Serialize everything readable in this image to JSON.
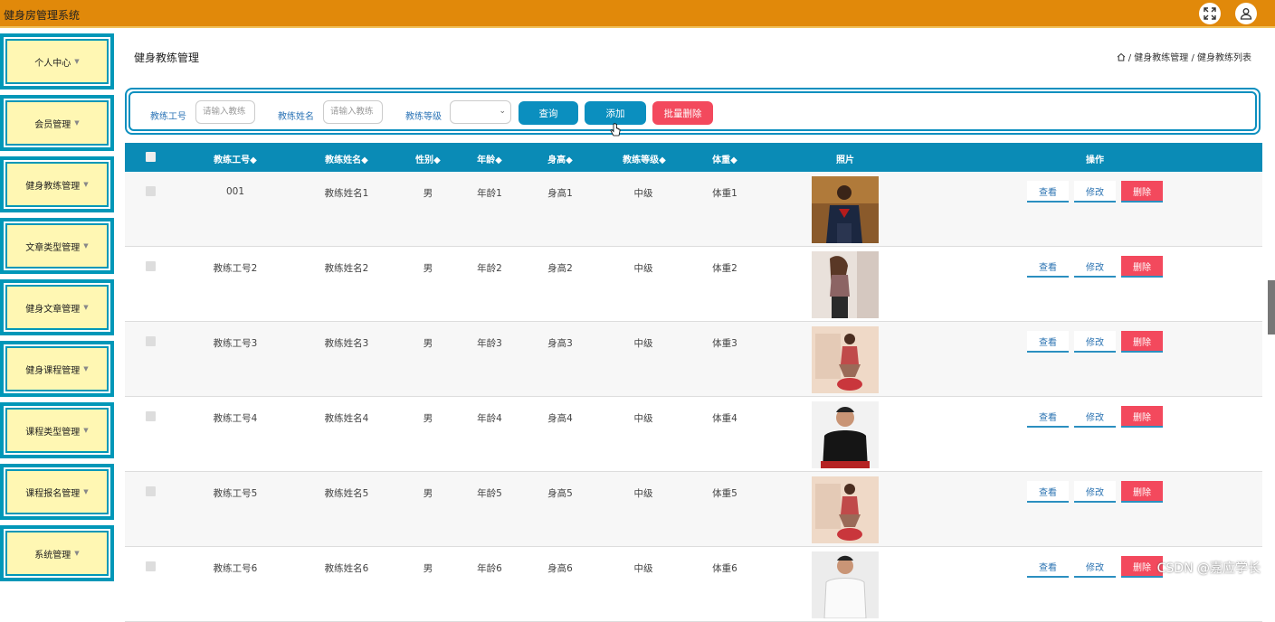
{
  "app": {
    "title": "健身房管理系统"
  },
  "sidebar": {
    "items": [
      {
        "label": "个人中心"
      },
      {
        "label": "会员管理"
      },
      {
        "label": "健身教练管理"
      },
      {
        "label": "文章类型管理"
      },
      {
        "label": "健身文章管理"
      },
      {
        "label": "健身课程管理"
      },
      {
        "label": "课程类型管理"
      },
      {
        "label": "课程报名管理"
      },
      {
        "label": "系统管理"
      }
    ]
  },
  "page": {
    "title": "健身教练管理",
    "breadcrumb": "/ 健身教练管理 / 健身教练列表"
  },
  "search": {
    "id_label": "教练工号",
    "id_placeholder": "请输入教练",
    "name_label": "教练姓名",
    "name_placeholder": "请输入教练",
    "level_label": "教练等级",
    "query": "查询",
    "add": "添加",
    "batch_delete": "批量删除"
  },
  "table": {
    "headers": [
      "教练工号◆",
      "教练姓名◆",
      "性别◆",
      "年龄◆",
      "身高◆",
      "教练等级◆",
      "体重◆",
      "照片",
      "操作"
    ],
    "actions": {
      "view": "查看",
      "edit": "修改",
      "delete": "删除"
    },
    "rows": [
      {
        "id": "001",
        "name": "教练姓名1",
        "gender": "男",
        "age": "年龄1",
        "height": "身高1",
        "level": "中级",
        "weight": "体重1",
        "photo": "man-dark-shirt"
      },
      {
        "id": "教练工号2",
        "name": "教练姓名2",
        "gender": "男",
        "age": "年龄2",
        "height": "身高2",
        "level": "中级",
        "weight": "体重2",
        "photo": "woman-tank-top"
      },
      {
        "id": "教练工号3",
        "name": "教练姓名3",
        "gender": "男",
        "age": "年龄3",
        "height": "身高3",
        "level": "中级",
        "weight": "体重3",
        "photo": "woman-yoga-ball"
      },
      {
        "id": "教练工号4",
        "name": "教练姓名4",
        "gender": "男",
        "age": "年龄4",
        "height": "身高4",
        "level": "中级",
        "weight": "体重4",
        "photo": "man-black-tshirt"
      },
      {
        "id": "教练工号5",
        "name": "教练姓名5",
        "gender": "男",
        "age": "年龄5",
        "height": "身高5",
        "level": "中级",
        "weight": "体重5",
        "photo": "woman-yoga-ball"
      },
      {
        "id": "教练工号6",
        "name": "教练姓名6",
        "gender": "男",
        "age": "年龄6",
        "height": "身高6",
        "level": "中级",
        "weight": "体重6",
        "photo": "man-white-shirt"
      }
    ]
  },
  "watermark": "CSDN @嘉应学长",
  "colors": {
    "header": "#e1890a",
    "accent": "#0b8fbf",
    "danger": "#f3495d",
    "nav_bg": "#fff7b3"
  }
}
